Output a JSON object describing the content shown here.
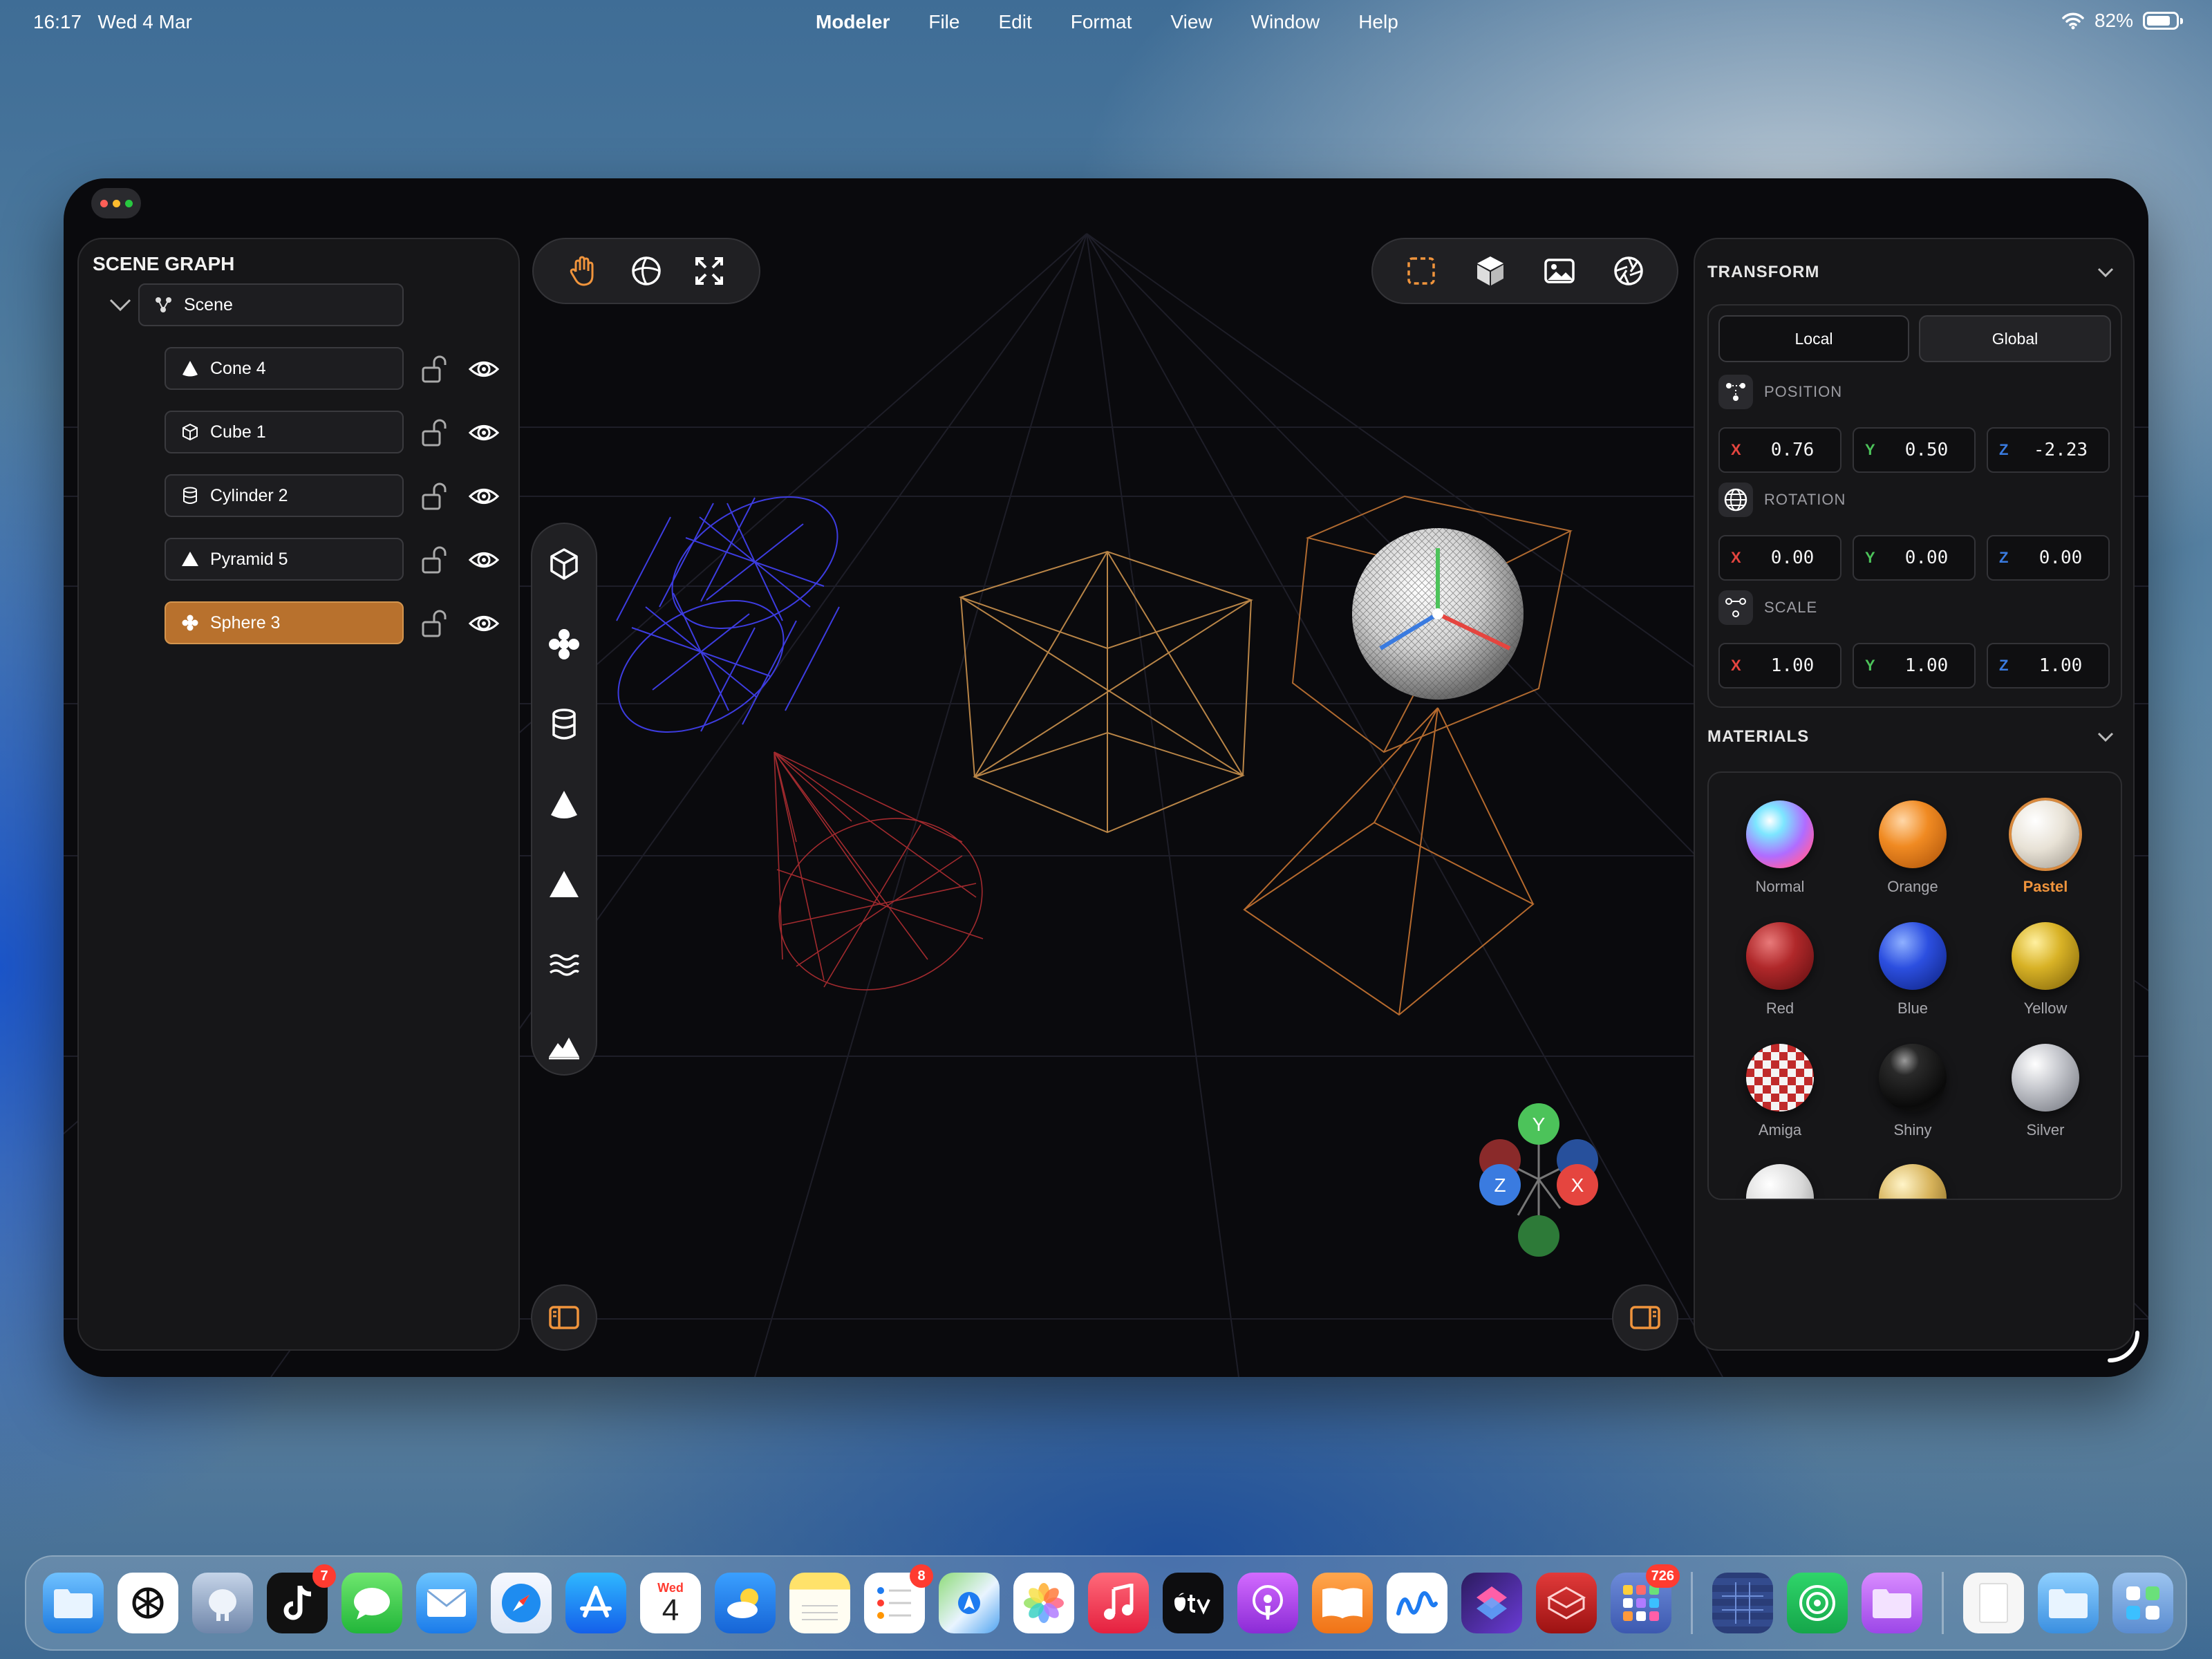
{
  "status_bar": {
    "time": "16:17",
    "date": "Wed 4 Mar",
    "battery": "82%",
    "battery_level": 0.82
  },
  "menu": {
    "app_name": "Modeler",
    "items": [
      "File",
      "Edit",
      "Format",
      "View",
      "Window",
      "Help"
    ]
  },
  "scene_graph": {
    "title": "SCENE GRAPH",
    "root": "Scene",
    "items": [
      {
        "label": "Cone 4",
        "icon": "cone-icon"
      },
      {
        "label": "Cube 1",
        "icon": "cube-icon"
      },
      {
        "label": "Cylinder 2",
        "icon": "cylinder-icon"
      },
      {
        "label": "Pyramid 5",
        "icon": "pyramid-icon"
      },
      {
        "label": "Sphere 3",
        "icon": "sphere-icon",
        "selected": true
      }
    ]
  },
  "toolbar_left": [
    "pan-hand-icon",
    "orbit-globe-icon",
    "fit-expand-icon"
  ],
  "toolbar_right": [
    "selection-marquee-icon",
    "solid-cube-icon",
    "image-icon",
    "camera-aperture-icon"
  ],
  "primitives": [
    "cube-icon",
    "sphere-icon",
    "cylinder-icon",
    "cone-icon",
    "pyramid-icon",
    "water-plane-icon",
    "terrain-icon"
  ],
  "gizmo": {
    "y": "Y",
    "x": "X",
    "z": "Z"
  },
  "transform": {
    "title": "TRANSFORM",
    "modes": [
      "Local",
      "Global"
    ],
    "position": {
      "label": "POSITION",
      "x": "0.76",
      "y": "0.50",
      "z": "-2.23"
    },
    "rotation": {
      "label": "ROTATION",
      "x": "0.00",
      "y": "0.00",
      "z": "0.00"
    },
    "scale": {
      "label": "SCALE",
      "x": "1.00",
      "y": "1.00",
      "z": "1.00"
    },
    "axis_labels": {
      "x": "X",
      "y": "Y",
      "z": "Z"
    }
  },
  "materials": {
    "title": "MATERIALS",
    "items": [
      {
        "name": "Normal"
      },
      {
        "name": "Orange"
      },
      {
        "name": "Pastel",
        "selected": true
      },
      {
        "name": "Red"
      },
      {
        "name": "Blue"
      },
      {
        "name": "Yellow"
      },
      {
        "name": "Amiga"
      },
      {
        "name": "Shiny"
      },
      {
        "name": "Silver"
      }
    ]
  },
  "colors": {
    "accent": "#f0943c",
    "axis_x": "#e5453f",
    "axis_y": "#4cc35a",
    "axis_z": "#3a7be0"
  },
  "dock": {
    "calendar_day": "Wed",
    "calendar_date": "4",
    "badges": {
      "tiktok": "7",
      "reminders": "8",
      "app_folder": "726"
    }
  }
}
